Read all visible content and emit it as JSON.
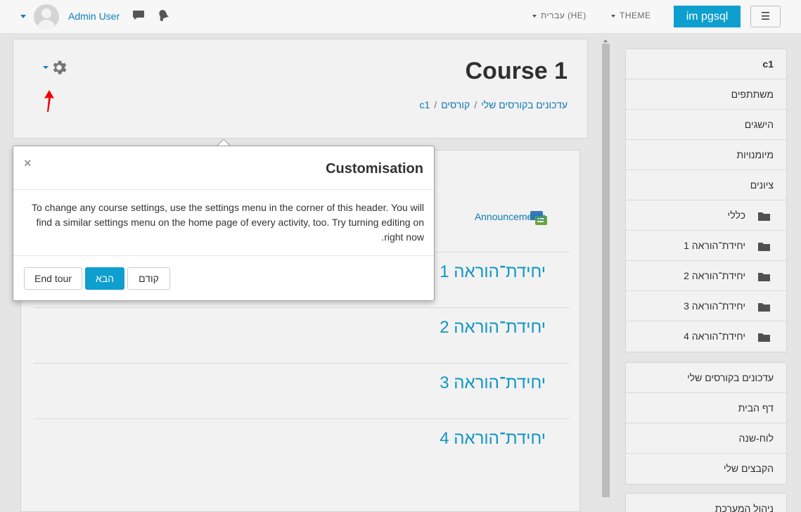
{
  "navbar": {
    "user_name": "Admin User",
    "language": "עברית (HE)",
    "theme": "THEME",
    "site_name": "im pgsql",
    "menu_icon": "hamburger-icon"
  },
  "header": {
    "title": "Course 1",
    "breadcrumb": [
      "עדכונים בקורסים שלי",
      "קורסים",
      "c1"
    ]
  },
  "content": {
    "announcements": "Announcements",
    "sections": [
      "יחידת־הוראה 1",
      "יחידת־הוראה 2",
      "יחידת־הוראה 3",
      "יחידת־הוראה 4"
    ]
  },
  "sidebar": {
    "nav_items": [
      {
        "label": "c1",
        "bold": true
      },
      {
        "label": "משתתפים"
      },
      {
        "label": "הישגים"
      },
      {
        "label": "מיומנויות"
      },
      {
        "label": "ציונים"
      },
      {
        "label": "כללי",
        "folder": true
      },
      {
        "label": "יחידת־הוראה 1",
        "folder": true
      },
      {
        "label": "יחידת־הוראה 2",
        "folder": true
      },
      {
        "label": "יחידת־הוראה 3",
        "folder": true
      },
      {
        "label": "יחידת־הוראה 4",
        "folder": true
      }
    ],
    "links": [
      "עדכונים בקורסים שלי",
      "דף הבית",
      "לוח-שנה",
      "הקבצים שלי"
    ],
    "admin": "ניהול המערכת"
  },
  "tour": {
    "title": "Customisation",
    "close": "×",
    "body": "To change any course settings, use the settings menu in the corner of this header. You will find a similar settings menu on the home page of every activity, too. Try turning editing on right now.",
    "end_tour": "End tour",
    "next": "הבא",
    "prev": "קודם"
  },
  "colors": {
    "link": "#0f7fc0",
    "brand": "#0f9fcf",
    "annotation_arrow": "#ff0000"
  }
}
